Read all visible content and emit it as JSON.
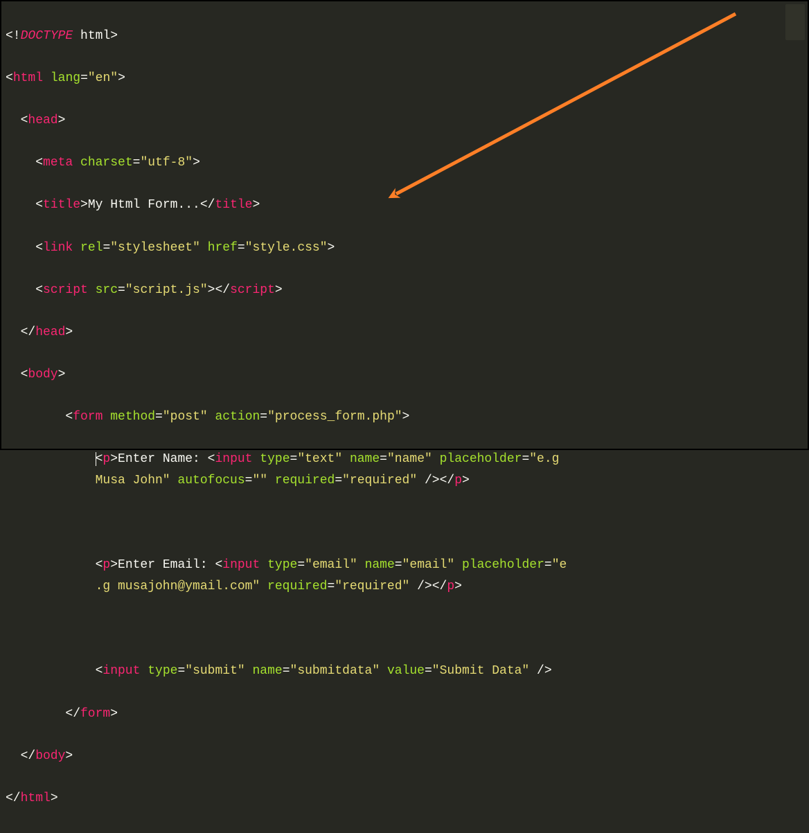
{
  "code": {
    "doctype_kw": "DOCTYPE",
    "doctype_val": "html",
    "html": {
      "tag": "html",
      "lang_attr": "lang",
      "lang_val": "\"en\""
    },
    "head": {
      "tag": "head"
    },
    "meta": {
      "tag": "meta",
      "charset_attr": "charset",
      "charset_val": "\"utf-8\""
    },
    "title": {
      "tag": "title",
      "text": "My Html Form..."
    },
    "link": {
      "tag": "link",
      "rel_attr": "rel",
      "rel_val": "\"stylesheet\"",
      "href_attr": "href",
      "href_val": "\"style.css\""
    },
    "script": {
      "tag": "script",
      "src_attr": "src",
      "src_val": "\"script.js\""
    },
    "body": {
      "tag": "body"
    },
    "form": {
      "tag": "form",
      "method_attr": "method",
      "method_val": "\"post\"",
      "action_attr": "action",
      "action_val": "\"process_form.php\""
    },
    "p": {
      "tag": "p"
    },
    "input_tag": "input",
    "name_field": {
      "label": "Enter Name: ",
      "type_attr": "type",
      "type_val": "\"text\"",
      "name_attr": "name",
      "name_val": "\"name\"",
      "ph_attr": "placeholder",
      "ph_val_a": "\"e.g ",
      "ph_val_b": "Musa John\"",
      "af_attr": "autofocus",
      "af_val": "\"\"",
      "req_attr": "required",
      "req_val": "\"required\""
    },
    "email_field": {
      "label": "Enter Email: ",
      "type_attr": "type",
      "type_val": "\"email\"",
      "name_attr": "name",
      "name_val": "\"email\"",
      "ph_attr": "placeholder",
      "ph_val_a": "\"e",
      "ph_val_b": ".g musajohn@ymail.com\"",
      "req_attr": "required",
      "req_val": "\"required\""
    },
    "submit_field": {
      "type_attr": "type",
      "type_val": "\"submit\"",
      "name_attr": "name",
      "name_val": "\"submitdata\"",
      "value_attr": "value",
      "value_val": "\"Submit Data\""
    }
  }
}
